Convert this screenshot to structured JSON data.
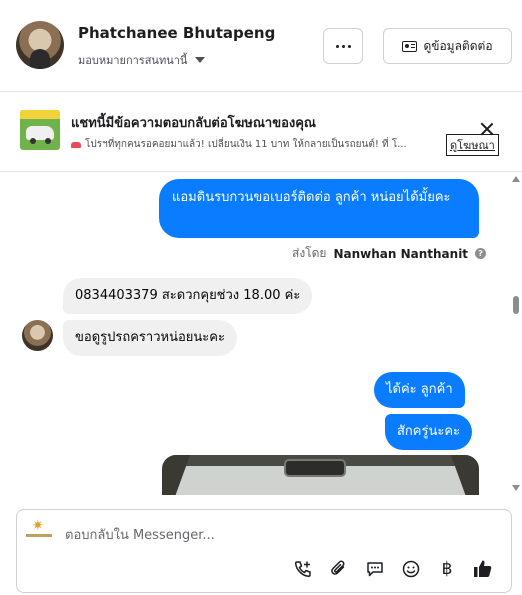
{
  "header": {
    "contact_name": "Phatchanee Bhutapeng",
    "assign_label": "มอบหมายการสนทนานี้",
    "contact_info_label": "ดูข้อมูลติดต่อ"
  },
  "ad": {
    "title": "แชทนี้มีข้อความตอบกลับต่อโฆษณาของคุณ",
    "description": "โปรฯที่ทุกคนรอคอยมาแล้ว! เปลี่ยนเงิน 11 บาท ให้กลายเป็นรถยนต์! ที่ โ...",
    "link_label": "ดูโฆษณา"
  },
  "messages": {
    "out1": "แอมดินรบกวนขอเบอร์ติดต่อ ลูกค้า  หน่อยได้มั้ยคะ",
    "sent_by_label": "ส่งโดย",
    "sent_by_name": "Nanwhan Nanthanit",
    "help_glyph": "?",
    "in1": "0834403379 สะดวกคุยช่วง 18.00 ค่ะ",
    "in2": "ขอดูรูปรถคราวหน่อยนะคะ",
    "out2": "ได้ค่ะ  ลูกค้า",
    "out3": "สักครู่นะคะ"
  },
  "composer": {
    "placeholder": "ตอบกลับใน Messenger...",
    "tools": [
      "call-add-icon",
      "attach-icon",
      "saved-replies-icon",
      "emoji-icon",
      "payment-icon",
      "like-icon"
    ],
    "baht_glyph": "฿"
  },
  "colors": {
    "outgoing_bubble": "#0a7cff",
    "incoming_bubble": "#f0f0f0"
  }
}
